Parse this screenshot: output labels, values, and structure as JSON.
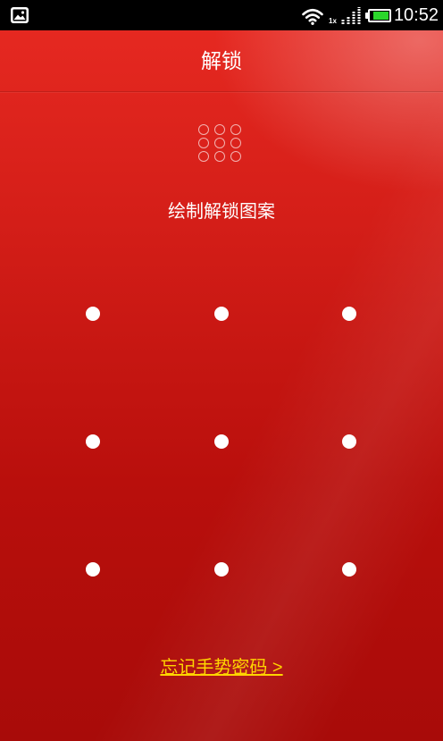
{
  "status_bar": {
    "time": "10:52",
    "network_type": "1x",
    "signal_bars": 4,
    "battery_level": 0.85,
    "icons": {
      "notification": "gallery-icon",
      "wifi": "wifi-icon",
      "signal": "signal-icon",
      "battery": "battery-icon"
    }
  },
  "header": {
    "title": "解锁"
  },
  "instruction": "绘制解锁图案",
  "forgot_link": {
    "label": "忘记手势密码 >"
  },
  "colors": {
    "status_bar_bg": "#000000",
    "background_top": "#e82a22",
    "background_bottom": "#a80b09",
    "link": "#ffd500",
    "battery_fill": "#2bd62b",
    "dot": "#ffffff"
  }
}
